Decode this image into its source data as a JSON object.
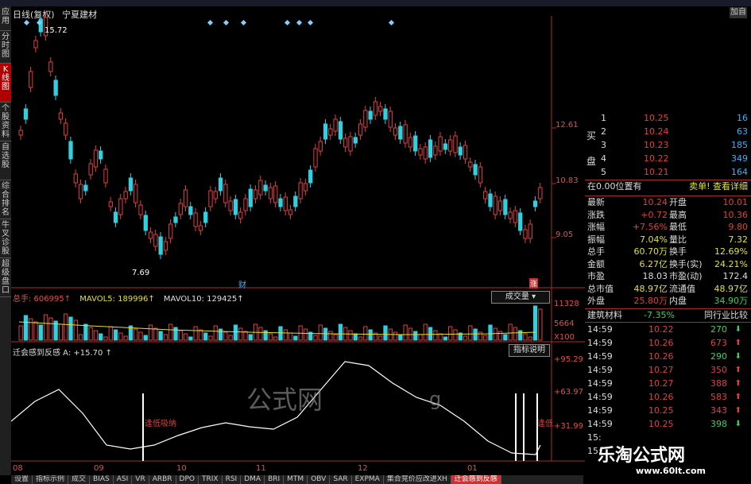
{
  "left_tabs": [
    {
      "label": "应用",
      "active": false
    },
    {
      "label": "分时图",
      "active": false
    },
    {
      "label": "K线图",
      "active": true
    },
    {
      "label": "个股资料",
      "active": false
    },
    {
      "label": "自选股",
      "active": false
    },
    {
      "label": "综合排名",
      "active": false
    },
    {
      "label": "牛叉诊股",
      "active": false
    },
    {
      "label": "超级盘口",
      "active": false
    }
  ],
  "header": {
    "period": "日线(复权)",
    "stock": "宁夏建材",
    "add_label": "加自"
  },
  "price_axis": {
    "labels": [
      "12.61",
      "10.83",
      "9.05"
    ]
  },
  "price_marks": {
    "high": "15.72",
    "low": "7.69",
    "tag1": "财",
    "tag2": "涨"
  },
  "volume": {
    "total_label": "总手: 606995↑",
    "mavol5_label": "MAVOL5: 189996↑",
    "mavol10_label": "MAVOL10: 129425↑",
    "dropdown": "成交量",
    "axis": [
      "11328",
      "5664",
      "X100"
    ]
  },
  "indicator": {
    "label": "迁会感到反感 A: +15.70 ↑",
    "btn": "指标说明",
    "axis": [
      "+95.29",
      "+63.97",
      "+31.99"
    ],
    "marker_text": "逢低吸纳",
    "marker_text2": "逢低"
  },
  "x_labels": [
    "08",
    "09",
    "10",
    "11",
    "12",
    "01"
  ],
  "bottom_tabs": [
    "设置",
    "指标示例",
    "成交",
    "BIAS",
    "ASI",
    "VR",
    "ARBR",
    "DPO",
    "TRIX",
    "RSI",
    "DMA",
    "BRI",
    "MTM",
    "OBV",
    "SAR",
    "EXPMA",
    "集合竞价应改进XH",
    "迁会感到反感"
  ],
  "order_book": {
    "sell_label": "卖",
    "buy_label": "买",
    "pan_label": "盘",
    "sells": [
      {
        "lv": "1",
        "price": "10.25",
        "vol": "16"
      },
      {
        "lv": "2",
        "price": "10.24",
        "vol": "63"
      },
      {
        "lv": "3",
        "price": "10.23",
        "vol": "185"
      },
      {
        "lv": "4",
        "price": "10.22",
        "vol": "349"
      },
      {
        "lv": "5",
        "price": "10.21",
        "vol": "164"
      }
    ]
  },
  "position_row": {
    "left": "在0.00位置有",
    "right": "卖单! 查看详细"
  },
  "stats": [
    {
      "k1": "最新",
      "v1": "10.24",
      "c1": "#e04040",
      "k2": "开盘",
      "v2": "10.01",
      "c2": "#e04040"
    },
    {
      "k1": "涨跌",
      "v1": "+0.72",
      "c1": "#e04040",
      "k2": "最高",
      "v2": "10.36",
      "c2": "#e04040"
    },
    {
      "k1": "涨幅",
      "v1": "+7.56%",
      "c1": "#e04040",
      "k2": "最低",
      "v2": "9.80",
      "c2": "#e04040"
    },
    {
      "k1": "振幅",
      "v1": "7.04%",
      "c1": "#e0e040",
      "k2": "量比",
      "v2": "7.32",
      "c2": "#e0e040"
    },
    {
      "k1": "总手",
      "v1": "60.70万",
      "c1": "#e0e040",
      "k2": "换手",
      "v2": "12.69%",
      "c2": "#e0e040"
    },
    {
      "k1": "金额",
      "v1": "6.27亿",
      "c1": "#e0e040",
      "k2": "换手(实)",
      "v2": "24.21%",
      "c2": "#e0e040"
    },
    {
      "k1": "市盈",
      "v1": "18.03",
      "c1": "#ddd",
      "k2": "市盈(动)",
      "v2": "172.4",
      "c2": "#ddd"
    },
    {
      "k1": "总市值",
      "v1": "48.97亿",
      "c1": "#e0e040",
      "k2": "流通值",
      "v2": "48.97亿",
      "c2": "#e0e040"
    },
    {
      "k1": "外盘",
      "v1": "25.80万",
      "c1": "#e04040",
      "k2": "内盘",
      "v2": "34.90万",
      "c2": "#3fd060"
    }
  ],
  "industry": {
    "name": "建筑材料",
    "change": "-7.35%",
    "compare": "同行业比较"
  },
  "trades": [
    {
      "t": "14:59",
      "p": "10.22",
      "q": "270",
      "dir": "down"
    },
    {
      "t": "14:59",
      "p": "10.26",
      "q": "673",
      "dir": "up"
    },
    {
      "t": "14:59",
      "p": "10.26",
      "q": "290",
      "dir": "down"
    },
    {
      "t": "14:59",
      "p": "10.27",
      "q": "350",
      "dir": "up"
    },
    {
      "t": "14:59",
      "p": "10.27",
      "q": "388",
      "dir": "up"
    },
    {
      "t": "14:59",
      "p": "10.26",
      "q": "583",
      "dir": "up"
    },
    {
      "t": "14:59",
      "p": "10.25",
      "q": "343",
      "dir": "up"
    },
    {
      "t": "14:59",
      "p": "10.25",
      "q": "398",
      "dir": "down"
    },
    {
      "t": "15:",
      "p": "",
      "q": "",
      "dir": ""
    },
    {
      "t": "15:",
      "p": "",
      "q": "",
      "dir": ""
    }
  ],
  "watermark": {
    "logo": "乐淘公式网",
    "url": "www.60lt.com",
    "wm": "公式网",
    "wm2": "g"
  },
  "colors": {
    "up": "#e04040",
    "down": "#30d0e0",
    "line": "#ffffff",
    "axis": "#a03030"
  }
}
